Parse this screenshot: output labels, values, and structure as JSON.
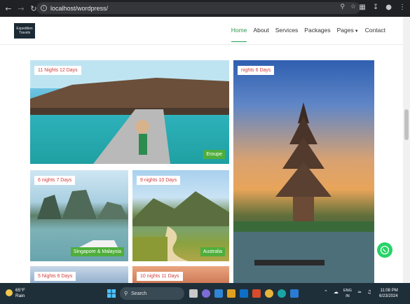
{
  "browser": {
    "url": "localhost/wordpress/",
    "back_icon": "arrow-left",
    "forward_icon": "arrow-right",
    "reload_icon": "reload"
  },
  "site": {
    "logo_text": "Expedition Travels",
    "menu": [
      {
        "label": "Home",
        "active": true
      },
      {
        "label": "About"
      },
      {
        "label": "Services"
      },
      {
        "label": "Packages"
      },
      {
        "label": "Pages"
      },
      {
        "label": "Contact"
      }
    ]
  },
  "packages": [
    {
      "duration": "11 Nights 12 Days",
      "location": "Eroupe"
    },
    {
      "duration": "nights 6 Days",
      "location": ""
    },
    {
      "duration": "6 nights 7 Days",
      "location": "Singapore & Malaysia"
    },
    {
      "duration": "9 nights 10 Days",
      "location": "Australia"
    },
    {
      "duration": "5 Nights 6 Days",
      "location": ""
    },
    {
      "duration": "10 nights 11 Days",
      "location": ""
    }
  ],
  "taskbar": {
    "weather_temp": "65°F",
    "weather_cond": "Rain",
    "search_label": "Search",
    "lang_top": "ENG",
    "lang_bottom": "IN",
    "time": "11:08 PM",
    "date": "6/23/2024"
  },
  "colors": {
    "accent": "#2e9b4e",
    "tag_text": "#d03c3c",
    "location_badge": "#4fae3b",
    "whatsapp": "#25d366"
  }
}
